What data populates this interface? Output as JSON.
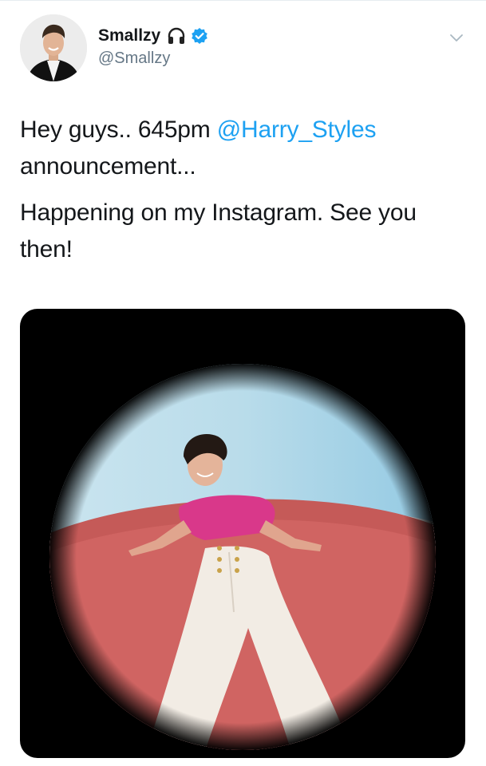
{
  "tweet": {
    "display_name": "Smallzy",
    "handle": "@Smallzy",
    "verified": true,
    "name_emoji": "headphones-icon",
    "text_line1_prefix": "Hey guys.. 645pm ",
    "mention": "@Harry_Styles",
    "text_line1_suffix": "announcement...",
    "text_paragraph2": "Happening on my Instagram. See you then!"
  },
  "colors": {
    "link": "#1da1f2",
    "verified": "#1da1f2",
    "text": "#14171a",
    "secondary": "#657786",
    "media_bg": "#000000"
  },
  "icons": [
    "headphones-icon",
    "verified-badge-icon",
    "chevron-down-icon"
  ]
}
